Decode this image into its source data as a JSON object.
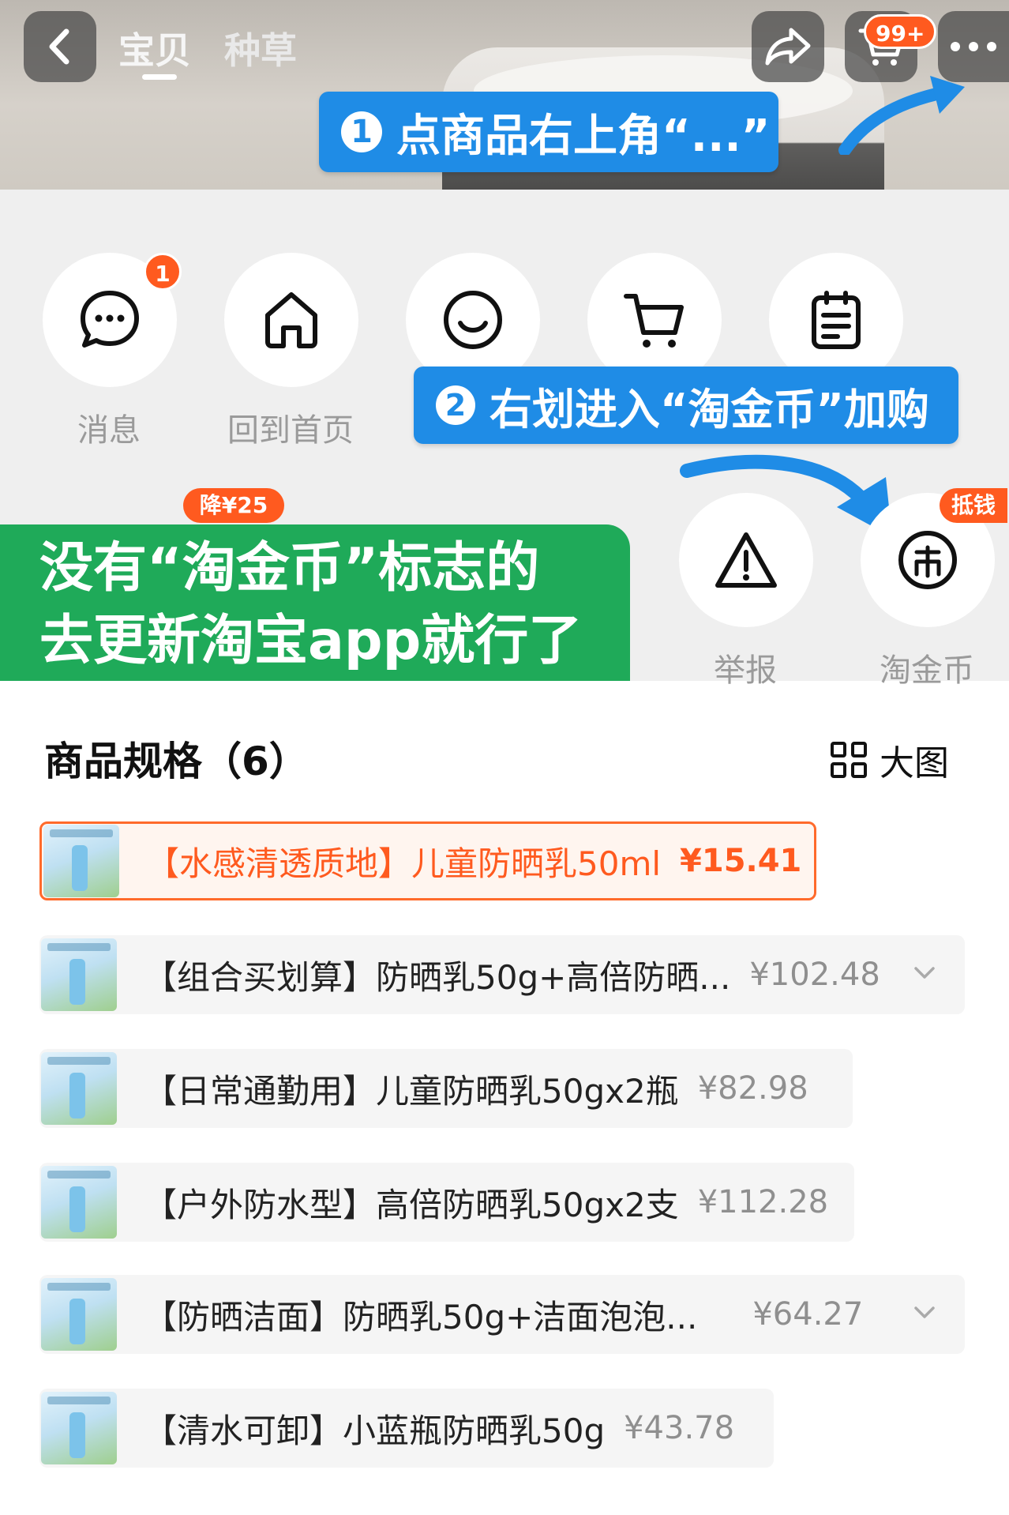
{
  "header": {
    "tabs": [
      "宝贝",
      "种草"
    ],
    "cart_badge": "99+"
  },
  "steps": {
    "step1_num": "1",
    "step1_text": "点商品右上角“...”",
    "step2_num": "2",
    "step2_text": "右划进入“淘金币”加购"
  },
  "menu": {
    "row1": [
      {
        "label": "消息",
        "icon": "chat-icon",
        "badge": "1"
      },
      {
        "label": "回到首页",
        "icon": "home-icon"
      },
      {
        "label": "",
        "icon": "smile-icon"
      },
      {
        "label": "",
        "icon": "cart-icon"
      },
      {
        "label": "",
        "icon": "clipboard-icon"
      }
    ],
    "row2_discount_badge": "降¥25",
    "report_label": "举报",
    "coin_label": "淘金币",
    "coin_badge": "抵钱"
  },
  "note": {
    "line1": "没有“淘金币”标志的",
    "line2": "去更新淘宝app就行了"
  },
  "spec": {
    "title": "商品规格（6）",
    "bigpic_label": "大图",
    "items": [
      {
        "name": "【水感清透质地】儿童防晒乳50ml",
        "price": "¥15.41",
        "selected": true
      },
      {
        "name": "【组合买划算】防晒乳50g+高倍防晒...",
        "price": "¥102.48"
      },
      {
        "name": "【日常通勤用】儿童防晒乳50gx2瓶",
        "price": "¥82.98"
      },
      {
        "name": "【户外防水型】高倍防晒乳50gx2支",
        "price": "¥112.28"
      },
      {
        "name": "【防晒洁面】防晒乳50g+洁面泡泡...",
        "price": "¥64.27"
      },
      {
        "name": "【清水可卸】小蓝瓶防晒乳50g",
        "price": "¥43.78"
      }
    ]
  },
  "colors": {
    "accent_orange": "#ff5a1f",
    "step_blue": "#1f8ce6",
    "note_green": "#1faa59"
  }
}
